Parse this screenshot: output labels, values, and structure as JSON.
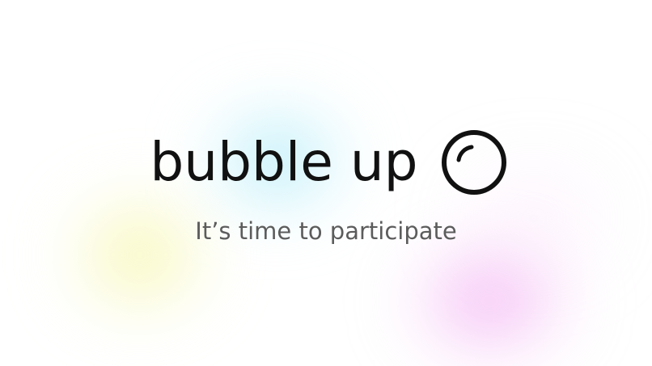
{
  "hero": {
    "title": "bubble up",
    "title_icon": "bubble-icon",
    "subtitle": "It’s time to participate"
  },
  "colors": {
    "background": "#ffffff",
    "title_text": "#111111",
    "subtitle_text": "#5c5c5c",
    "glow_cyan": "#96e4f5",
    "glow_yellow": "#f5f596",
    "glow_pink": "#f0a0f0"
  }
}
